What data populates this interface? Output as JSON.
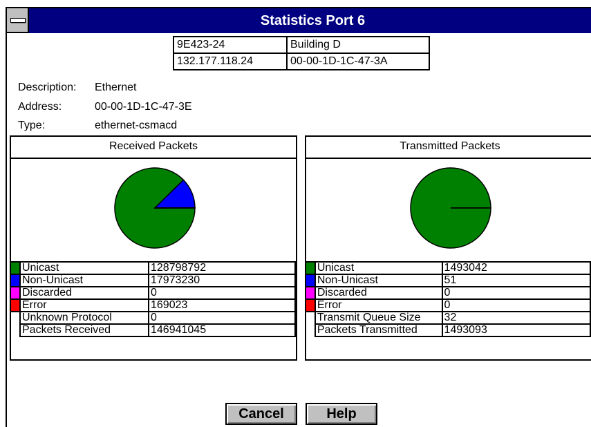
{
  "window": {
    "title": "Statistics Port 6"
  },
  "id_table": {
    "row1": [
      "9E423-24",
      "Building D"
    ],
    "row2": [
      "132.177.118.24",
      "00-00-1D-1C-47-3A"
    ]
  },
  "info": {
    "description_label": "Description:",
    "description_value": "Ethernet",
    "address_label": "Address:",
    "address_value": "00-00-1D-1C-47-3E",
    "type_label": "Type:",
    "type_value": "ethernet-csmacd"
  },
  "received": {
    "title": "Received Packets",
    "rows": [
      {
        "label": "Unicast",
        "value": "128798792",
        "color": "#008000"
      },
      {
        "label": "Non-Unicast",
        "value": "17973230",
        "color": "#0000ff"
      },
      {
        "label": "Discarded",
        "value": "0",
        "color": "#ff00ff"
      },
      {
        "label": "Error",
        "value": "169023",
        "color": "#ff0000"
      },
      {
        "label": "Unknown Protocol",
        "value": "0"
      },
      {
        "label": "Packets Received",
        "value": "146941045"
      }
    ]
  },
  "transmitted": {
    "title": "Transmitted Packets",
    "rows": [
      {
        "label": "Unicast",
        "value": "1493042",
        "color": "#008000"
      },
      {
        "label": "Non-Unicast",
        "value": "51",
        "color": "#0000ff"
      },
      {
        "label": "Discarded",
        "value": "0",
        "color": "#ff00ff"
      },
      {
        "label": "Error",
        "value": "0",
        "color": "#ff0000"
      },
      {
        "label": "Transmit Queue Size",
        "value": "32"
      },
      {
        "label": "Packets Transmitted",
        "value": "1493093"
      }
    ]
  },
  "buttons": {
    "cancel": "Cancel",
    "help": "Help"
  }
}
